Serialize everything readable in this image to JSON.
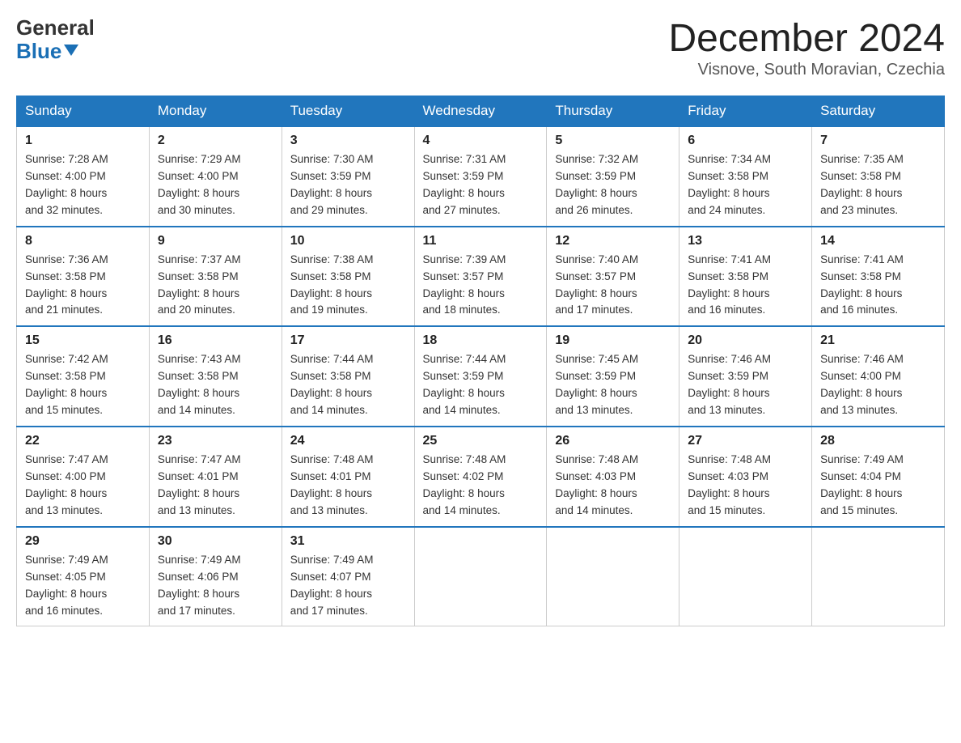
{
  "header": {
    "logo_general": "General",
    "logo_blue": "Blue",
    "title": "December 2024",
    "subtitle": "Visnove, South Moravian, Czechia"
  },
  "calendar": {
    "days_of_week": [
      "Sunday",
      "Monday",
      "Tuesday",
      "Wednesday",
      "Thursday",
      "Friday",
      "Saturday"
    ],
    "weeks": [
      [
        {
          "day": "1",
          "sunrise": "7:28 AM",
          "sunset": "4:00 PM",
          "daylight": "8 hours and 32 minutes."
        },
        {
          "day": "2",
          "sunrise": "7:29 AM",
          "sunset": "4:00 PM",
          "daylight": "8 hours and 30 minutes."
        },
        {
          "day": "3",
          "sunrise": "7:30 AM",
          "sunset": "3:59 PM",
          "daylight": "8 hours and 29 minutes."
        },
        {
          "day": "4",
          "sunrise": "7:31 AM",
          "sunset": "3:59 PM",
          "daylight": "8 hours and 27 minutes."
        },
        {
          "day": "5",
          "sunrise": "7:32 AM",
          "sunset": "3:59 PM",
          "daylight": "8 hours and 26 minutes."
        },
        {
          "day": "6",
          "sunrise": "7:34 AM",
          "sunset": "3:58 PM",
          "daylight": "8 hours and 24 minutes."
        },
        {
          "day": "7",
          "sunrise": "7:35 AM",
          "sunset": "3:58 PM",
          "daylight": "8 hours and 23 minutes."
        }
      ],
      [
        {
          "day": "8",
          "sunrise": "7:36 AM",
          "sunset": "3:58 PM",
          "daylight": "8 hours and 21 minutes."
        },
        {
          "day": "9",
          "sunrise": "7:37 AM",
          "sunset": "3:58 PM",
          "daylight": "8 hours and 20 minutes."
        },
        {
          "day": "10",
          "sunrise": "7:38 AM",
          "sunset": "3:58 PM",
          "daylight": "8 hours and 19 minutes."
        },
        {
          "day": "11",
          "sunrise": "7:39 AM",
          "sunset": "3:57 PM",
          "daylight": "8 hours and 18 minutes."
        },
        {
          "day": "12",
          "sunrise": "7:40 AM",
          "sunset": "3:57 PM",
          "daylight": "8 hours and 17 minutes."
        },
        {
          "day": "13",
          "sunrise": "7:41 AM",
          "sunset": "3:58 PM",
          "daylight": "8 hours and 16 minutes."
        },
        {
          "day": "14",
          "sunrise": "7:41 AM",
          "sunset": "3:58 PM",
          "daylight": "8 hours and 16 minutes."
        }
      ],
      [
        {
          "day": "15",
          "sunrise": "7:42 AM",
          "sunset": "3:58 PM",
          "daylight": "8 hours and 15 minutes."
        },
        {
          "day": "16",
          "sunrise": "7:43 AM",
          "sunset": "3:58 PM",
          "daylight": "8 hours and 14 minutes."
        },
        {
          "day": "17",
          "sunrise": "7:44 AM",
          "sunset": "3:58 PM",
          "daylight": "8 hours and 14 minutes."
        },
        {
          "day": "18",
          "sunrise": "7:44 AM",
          "sunset": "3:59 PM",
          "daylight": "8 hours and 14 minutes."
        },
        {
          "day": "19",
          "sunrise": "7:45 AM",
          "sunset": "3:59 PM",
          "daylight": "8 hours and 13 minutes."
        },
        {
          "day": "20",
          "sunrise": "7:46 AM",
          "sunset": "3:59 PM",
          "daylight": "8 hours and 13 minutes."
        },
        {
          "day": "21",
          "sunrise": "7:46 AM",
          "sunset": "4:00 PM",
          "daylight": "8 hours and 13 minutes."
        }
      ],
      [
        {
          "day": "22",
          "sunrise": "7:47 AM",
          "sunset": "4:00 PM",
          "daylight": "8 hours and 13 minutes."
        },
        {
          "day": "23",
          "sunrise": "7:47 AM",
          "sunset": "4:01 PM",
          "daylight": "8 hours and 13 minutes."
        },
        {
          "day": "24",
          "sunrise": "7:48 AM",
          "sunset": "4:01 PM",
          "daylight": "8 hours and 13 minutes."
        },
        {
          "day": "25",
          "sunrise": "7:48 AM",
          "sunset": "4:02 PM",
          "daylight": "8 hours and 14 minutes."
        },
        {
          "day": "26",
          "sunrise": "7:48 AM",
          "sunset": "4:03 PM",
          "daylight": "8 hours and 14 minutes."
        },
        {
          "day": "27",
          "sunrise": "7:48 AM",
          "sunset": "4:03 PM",
          "daylight": "8 hours and 15 minutes."
        },
        {
          "day": "28",
          "sunrise": "7:49 AM",
          "sunset": "4:04 PM",
          "daylight": "8 hours and 15 minutes."
        }
      ],
      [
        {
          "day": "29",
          "sunrise": "7:49 AM",
          "sunset": "4:05 PM",
          "daylight": "8 hours and 16 minutes."
        },
        {
          "day": "30",
          "sunrise": "7:49 AM",
          "sunset": "4:06 PM",
          "daylight": "8 hours and 17 minutes."
        },
        {
          "day": "31",
          "sunrise": "7:49 AM",
          "sunset": "4:07 PM",
          "daylight": "8 hours and 17 minutes."
        },
        null,
        null,
        null,
        null
      ]
    ],
    "labels": {
      "sunrise": "Sunrise:",
      "sunset": "Sunset:",
      "daylight": "Daylight:"
    }
  }
}
